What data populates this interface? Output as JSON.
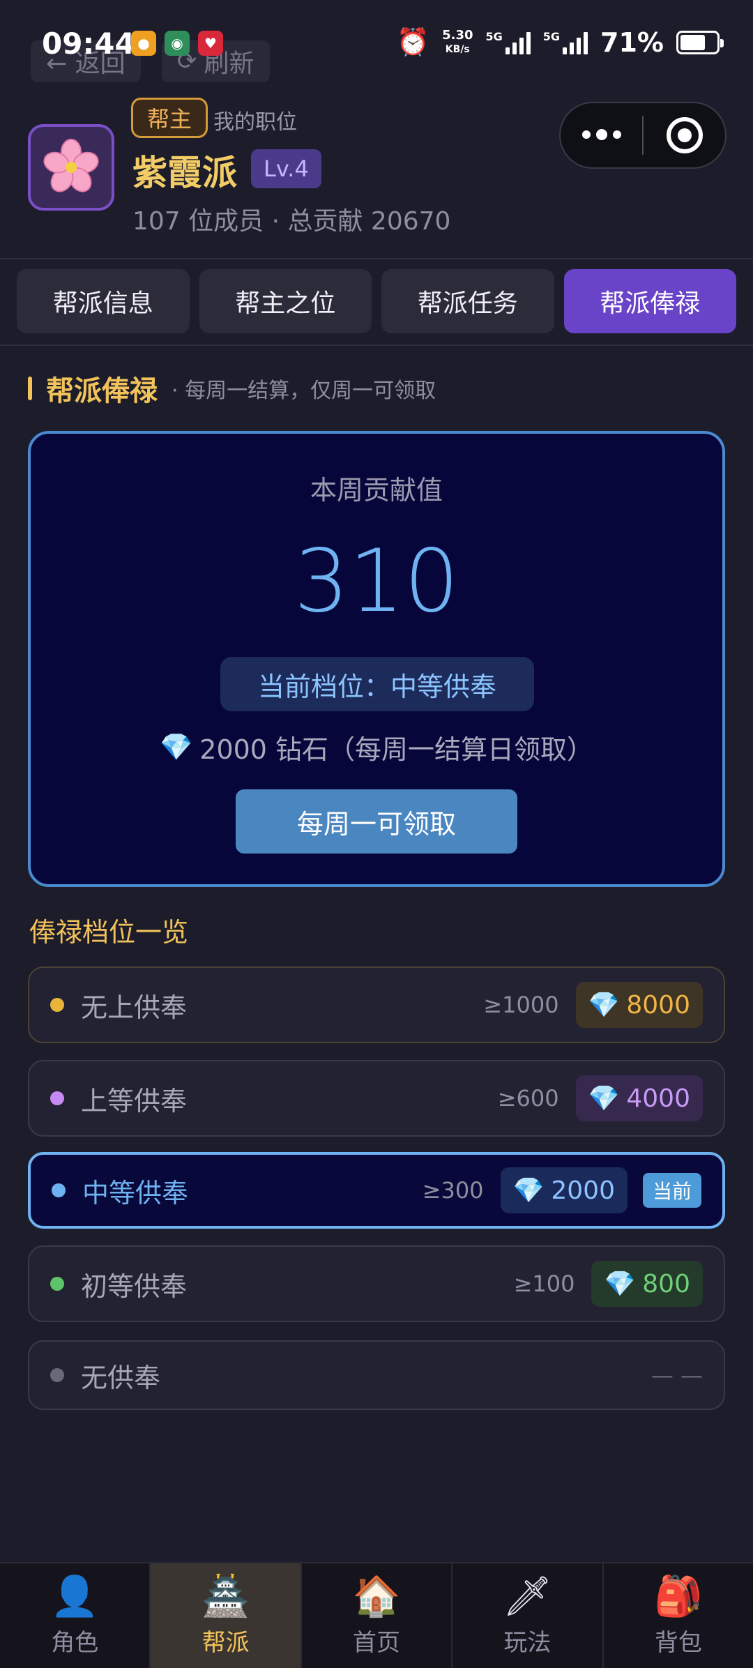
{
  "status_bar": {
    "time": "09:44",
    "speed_value": "5.30",
    "speed_unit": "KB/s",
    "net1": "5G",
    "net2": "5G",
    "battery": "71%"
  },
  "top_nav": {
    "back_label": "← 返回",
    "refresh_label": "刷新"
  },
  "header": {
    "role_badge": "帮主",
    "role_sub": "我的职位",
    "guild_name": "紫霞派",
    "level": "Lv.4",
    "stats": "107 位成员 · 总贡献 20670"
  },
  "tabs": [
    {
      "label": "帮派信息"
    },
    {
      "label": "帮主之位"
    },
    {
      "label": "帮派任务"
    },
    {
      "label": "帮派俸禄"
    }
  ],
  "section": {
    "title": "帮派俸禄",
    "subtitle": "· 每周一结算，仅周一可领取"
  },
  "weekly_card": {
    "label": "本周贡献值",
    "value": "310",
    "tier": "当前档位：中等供奉",
    "reward": "2000 钻石（每周一结算日领取）",
    "button": "每周一可领取"
  },
  "tier_list": {
    "title": "俸禄档位一览",
    "rows": [
      {
        "name": "无上供奉",
        "req": "≥1000",
        "reward": "8000",
        "dot_color": "#e8b53a",
        "reward_bg": "#3e3526",
        "reward_color": "#f0b545"
      },
      {
        "name": "上等供奉",
        "req": "≥600",
        "reward": "4000",
        "dot_color": "#c78af2",
        "reward_bg": "#37284e",
        "reward_color": "#c99af5"
      },
      {
        "name": "中等供奉",
        "req": "≥300",
        "reward": "2000",
        "dot_color": "#6fb2f2",
        "reward_bg": "#1a2a5a",
        "reward_color": "#8cc4ff",
        "current_tag": "当前"
      },
      {
        "name": "初等供奉",
        "req": "≥100",
        "reward": "800",
        "dot_color": "#5dc46a",
        "reward_bg": "#243a2a",
        "reward_color": "#6fd07a"
      },
      {
        "name": "无供奉",
        "req": "— —",
        "dot_color": "#6a6978"
      }
    ]
  },
  "bottom_nav": [
    {
      "label": "角色",
      "icon": "person-icon"
    },
    {
      "label": "帮派",
      "icon": "castle-icon"
    },
    {
      "label": "首页",
      "icon": "house-icon"
    },
    {
      "label": "玩法",
      "icon": "sword-icon"
    },
    {
      "label": "背包",
      "icon": "backpack-icon"
    }
  ]
}
